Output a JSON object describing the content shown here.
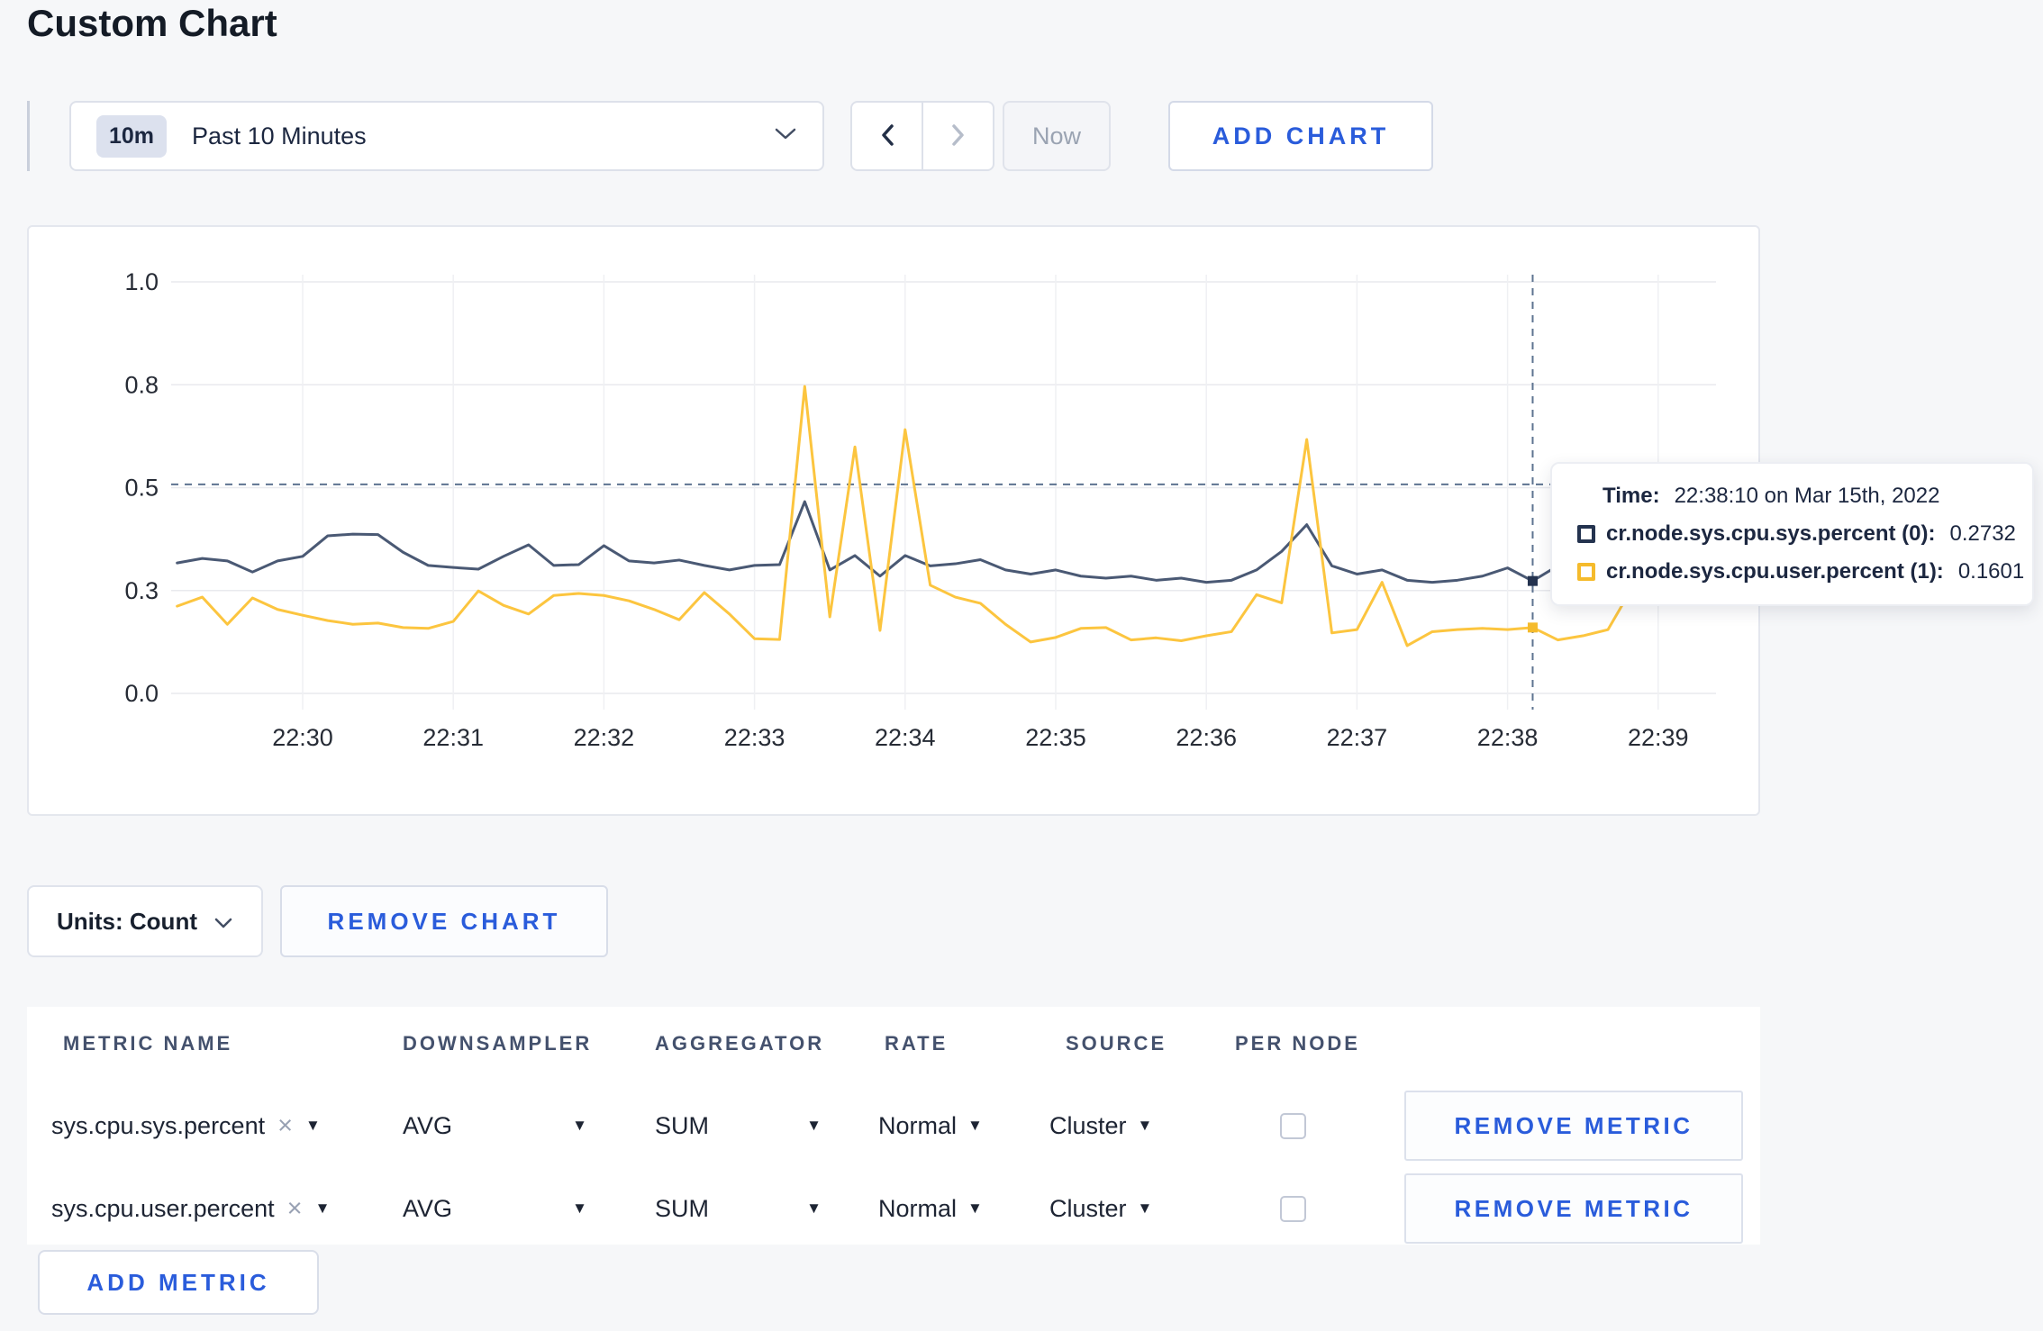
{
  "page": {
    "title": "Custom Chart"
  },
  "icons": {
    "caret_down": "▼",
    "close": "×",
    "chevron_down": "⌄",
    "chevron_left": "‹",
    "chevron_right": "›"
  },
  "toolbar": {
    "range_badge": "10m",
    "range_label": "Past 10 Minutes",
    "now_label": "Now",
    "add_chart_label": "ADD CHART"
  },
  "chart_tooltip": {
    "time_label": "Time:",
    "time_value": "22:38:10 on Mar 15th, 2022",
    "series": [
      {
        "label": "cr.node.sys.cpu.sys.percent (0):",
        "value": "0.2732",
        "swatch_color": "#24334f"
      },
      {
        "label": "cr.node.sys.cpu.user.percent (1):",
        "value": "0.1601",
        "swatch_color": "#f5bb2c"
      }
    ]
  },
  "chart_data": {
    "type": "line",
    "title": "",
    "xlabel": "",
    "ylabel": "",
    "ylim": [
      0,
      1
    ],
    "grid": true,
    "legend_position": "tooltip",
    "x_tick_labels": [
      "22:30",
      "22:31",
      "22:32",
      "22:33",
      "22:34",
      "22:35",
      "22:36",
      "22:37",
      "22:38",
      "22:39"
    ],
    "y_ticks": [
      {
        "value": 0.0,
        "label": "0.0"
      },
      {
        "value": 0.25,
        "label": "0.3"
      },
      {
        "value": 0.5,
        "label": "0.5"
      },
      {
        "value": 0.75,
        "label": "0.8"
      },
      {
        "value": 1.0,
        "label": "1.0"
      }
    ],
    "start_time": "22:29:10",
    "interval_seconds": 10,
    "series": [
      {
        "name": "cr.node.sys.cpu.sys.percent",
        "color": "#4a5974",
        "values": [
          0.317,
          0.328,
          0.322,
          0.295,
          0.322,
          0.333,
          0.383,
          0.387,
          0.386,
          0.343,
          0.311,
          0.306,
          0.302,
          0.333,
          0.361,
          0.311,
          0.313,
          0.359,
          0.322,
          0.317,
          0.324,
          0.311,
          0.3,
          0.311,
          0.313,
          0.466,
          0.3,
          0.335,
          0.285,
          0.335,
          0.31,
          0.315,
          0.325,
          0.3,
          0.29,
          0.3,
          0.285,
          0.28,
          0.285,
          0.275,
          0.28,
          0.27,
          0.275,
          0.3,
          0.345,
          0.41,
          0.31,
          0.29,
          0.3,
          0.275,
          0.27,
          0.275,
          0.285,
          0.305,
          0.2732,
          0.31,
          0.3,
          0.295,
          0.3,
          0.3
        ]
      },
      {
        "name": "cr.node.sys.cpu.user.percent",
        "color": "#fcc53f",
        "values": [
          0.212,
          0.234,
          0.168,
          0.232,
          0.204,
          0.19,
          0.177,
          0.168,
          0.171,
          0.16,
          0.158,
          0.175,
          0.249,
          0.214,
          0.193,
          0.238,
          0.243,
          0.238,
          0.225,
          0.204,
          0.179,
          0.245,
          0.193,
          0.133,
          0.131,
          0.746,
          0.186,
          0.599,
          0.153,
          0.641,
          0.263,
          0.234,
          0.219,
          0.168,
          0.125,
          0.136,
          0.158,
          0.16,
          0.13,
          0.135,
          0.128,
          0.14,
          0.15,
          0.24,
          0.22,
          0.617,
          0.147,
          0.155,
          0.27,
          0.116,
          0.15,
          0.155,
          0.158,
          0.155,
          0.1601,
          0.13,
          0.14,
          0.155,
          0.26,
          0.24
        ]
      }
    ],
    "crosshair": {
      "index": 54,
      "time": "22:38:10",
      "hline_value": 0.508
    }
  },
  "units_row": {
    "units_label": "Units: Count",
    "remove_chart_label": "REMOVE CHART"
  },
  "metrics_table": {
    "headers": [
      "METRIC NAME",
      "DOWNSAMPLER",
      "AGGREGATOR",
      "RATE",
      "SOURCE",
      "PER NODE"
    ],
    "rows": [
      {
        "metric": "sys.cpu.sys.percent",
        "downsampler": "AVG",
        "aggregator": "SUM",
        "rate": "Normal",
        "source": "Cluster",
        "per_node_checked": false,
        "remove_label": "REMOVE METRIC"
      },
      {
        "metric": "sys.cpu.user.percent",
        "downsampler": "AVG",
        "aggregator": "SUM",
        "rate": "Normal",
        "source": "Cluster",
        "per_node_checked": false,
        "remove_label": "REMOVE METRIC"
      }
    ],
    "add_metric_label": "ADD METRIC"
  }
}
